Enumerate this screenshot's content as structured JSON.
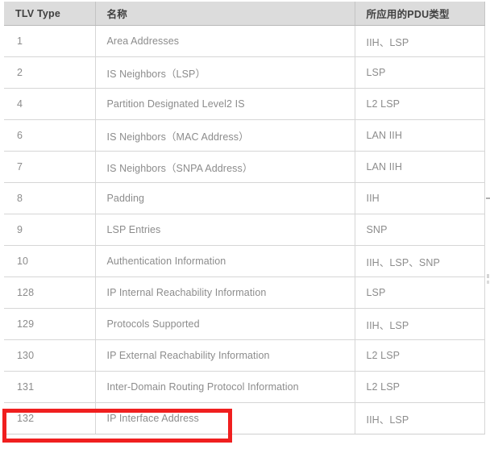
{
  "table": {
    "columns": [
      "TLV Type",
      "名称",
      "所应用的PDU类型"
    ],
    "rows": [
      {
        "type": "1",
        "name": "Area Addresses",
        "pdu": "IIH、LSP"
      },
      {
        "type": "2",
        "name": "IS Neighbors（LSP）",
        "pdu": "LSP"
      },
      {
        "type": "4",
        "name": "Partition Designated Level2 IS",
        "pdu": "L2 LSP"
      },
      {
        "type": "6",
        "name": "IS Neighbors（MAC Address）",
        "pdu": "LAN IIH"
      },
      {
        "type": "7",
        "name": "IS Neighbors（SNPA Address）",
        "pdu": "LAN IIH"
      },
      {
        "type": "8",
        "name": "Padding",
        "pdu": "IIH"
      },
      {
        "type": "9",
        "name": "LSP Entries",
        "pdu": "SNP"
      },
      {
        "type": "10",
        "name": "Authentication Information",
        "pdu": "IIH、LSP、SNP"
      },
      {
        "type": "128",
        "name": "IP Internal Reachability Information",
        "pdu": "LSP"
      },
      {
        "type": "129",
        "name": "Protocols Supported",
        "pdu": "IIH、LSP"
      },
      {
        "type": "130",
        "name": "IP External Reachability Information",
        "pdu": "L2 LSP"
      },
      {
        "type": "131",
        "name": "Inter-Domain Routing Protocol Information",
        "pdu": "L2 LSP"
      },
      {
        "type": "132",
        "name": "IP Interface Address",
        "pdu": "IIH、LSP"
      }
    ]
  },
  "annotation": {
    "highlighted_row_type": "132",
    "color": "#f01f1f"
  },
  "colors": {
    "header_background": "#dcdcdc",
    "header_text": "#404040",
    "body_text": "#8c8c8c",
    "grid_line": "#d6d6d6",
    "page_background": "#ffffff"
  }
}
